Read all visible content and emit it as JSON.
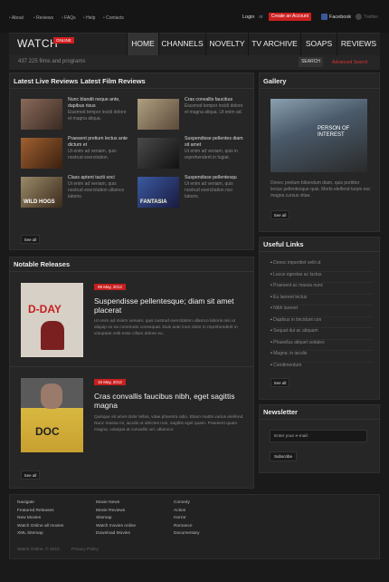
{
  "topnav": {
    "links": [
      "About",
      "Reviews",
      "FAQs",
      "Help",
      "Contacts"
    ],
    "login": "Login",
    "or": "or",
    "create_account": "Create an Account",
    "facebook": "Facebook",
    "twitter": "Twitter"
  },
  "header": {
    "logo": "WATCH",
    "logo_badge": "ONLINE",
    "nav": [
      "HOME",
      "CHANNELS",
      "NOVELTY",
      "TV ARCHIVE",
      "SOAPS",
      "REVIEWS"
    ]
  },
  "search": {
    "count_text": "437 225 films and programs",
    "button": "SEARCH",
    "advanced": "Advanced Search"
  },
  "reviews": {
    "live_heading": "Latest Live Reviews",
    "film_heading": "Latest Film Reviews",
    "items": [
      {
        "title": "Nunc blandit neque ante, dapibus risus",
        "text": "Eiusmod tempor incidi dolore et magna aliqua.",
        "thumb_color": "#6b4a3a"
      },
      {
        "title": "Cras convallis faucibus",
        "text": "Eiusmod tempor incidi dolore et magna aliqua. Ut enim ad.",
        "thumb_color": "#8a7a5a"
      },
      {
        "title": "Praesent pretium lectus ante dictum et",
        "text": "Ut enim ad veniam, quis nostrud exercitation.",
        "thumb_color": "#7a4a2a"
      },
      {
        "title": "Suspendisse pellentes diam sit amet",
        "text": "Ut enim ad veniam, quis in reprehenderit in fugiat.",
        "thumb_color": "#3a3a3a"
      },
      {
        "title": "Class aptent taciti soci",
        "text": "Ut enim ad veniam, quis nostrud exercitation ullamco laboris.",
        "thumb_color": "#6a5a4a",
        "thumb_label": "WILD HOGS"
      },
      {
        "title": "Suspendisse pellentesqu",
        "text": "Ut enim ad veniam, quis nostrud exercitation nco laboris.",
        "thumb_color": "#2a3a6a",
        "thumb_label": "FANTASIA"
      }
    ],
    "see_all": "See all"
  },
  "gallery": {
    "heading": "Gallery",
    "poster_title": "PERSON OF INTEREST",
    "text": "Donec pretium bibendum diam, quis porttitor lectus pellentesque quis. Morbi eleifend turpis nec magna cursus vitae.",
    "see_all": "See all"
  },
  "notable": {
    "heading": "Notable Releases",
    "items": [
      {
        "date": "06 May, 2012",
        "title": "Suspendisse pellentesque; diam sit amet placerat",
        "text": "Ut enim ad minim veniam, quis nostrud exercitation ullamco laboris nisi ut aliquip ex ea commodo consequat. Duis aute irure dolor in reprehenderit in voluptate velit esse cillum dolore eu.",
        "poster": "D-DAY",
        "poster_color": "#c9c4bb"
      },
      {
        "date": "15 May, 2012",
        "title": "Cras convallis faucibus nibh, eget sagittis magna",
        "text": "Quisque sit amet dolor tellus, vitae pharetra odio. Etiam mattis varius eleifend. Nunc massa mi, iaculis ut ultricies non, sagittis eget quam. Praesent quam magna, volutpat at convallis vel, ullamcor.",
        "poster": "DOC",
        "poster_color": "#d0b84a"
      }
    ],
    "see_all": "See all"
  },
  "useful_links": {
    "heading": "Useful Links",
    "items": [
      "Donec imperdiet velit ut",
      "Lacus egestas ac luctus",
      "Praesent ac massa nunc",
      "Eu laoreet lectus",
      "Nibh laoreet",
      "Dapibus in tincidunt con",
      "Sequat dui ac aliquam",
      "Phasellus aliquet sodales",
      "Magna; in iaculis",
      "Condimentum"
    ],
    "see_all": "See all"
  },
  "newsletter": {
    "heading": "Newsletter",
    "placeholder": "Enter your e-mail:",
    "subscribe": "Subscribe"
  },
  "footer": {
    "col1": [
      "Navigate",
      "Featured Releases",
      "New Movies",
      "Watch Online all movies",
      "XML Sitemap"
    ],
    "col2": [
      "Movie News",
      "Movie Reviews",
      "Sitemap",
      "Watch movies online",
      "Download Movies"
    ],
    "col3": [
      "Comedy",
      "Action",
      "Horror",
      "Romance",
      "Documentary"
    ],
    "copyright": "Watch Online. © 2012",
    "privacy": "Privacy Policy"
  }
}
